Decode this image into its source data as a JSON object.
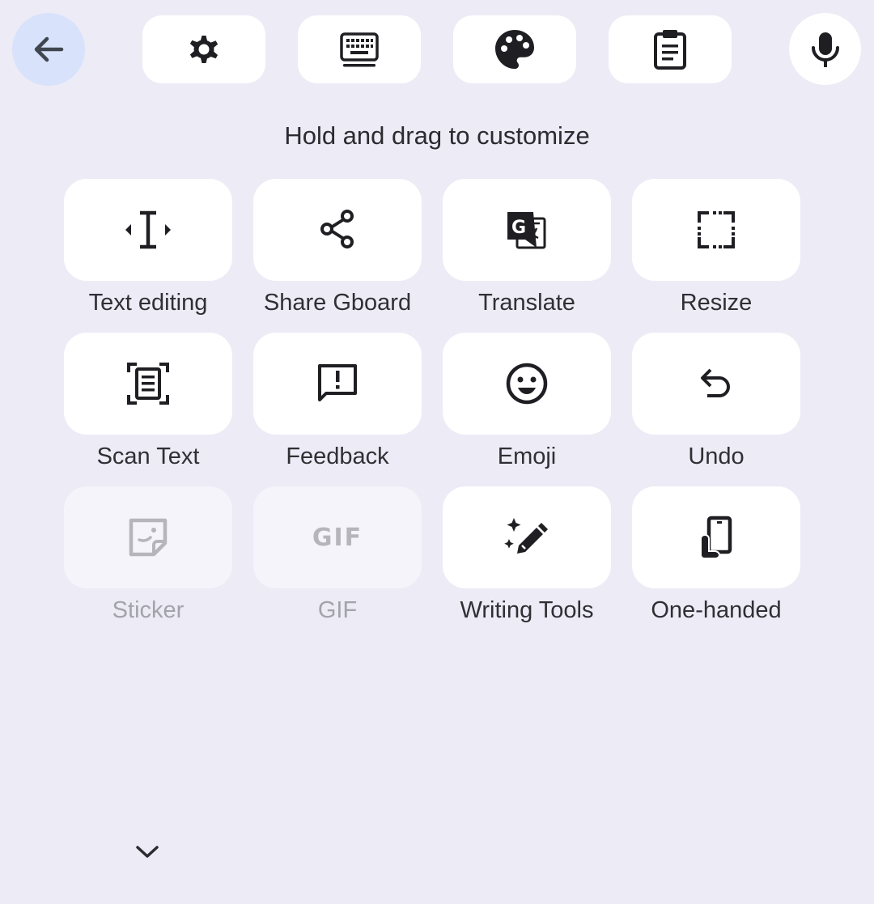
{
  "toolbar": {
    "back_icon": "arrow-left-icon",
    "items": [
      {
        "icon": "gear-icon"
      },
      {
        "icon": "keyboard-icon"
      },
      {
        "icon": "palette-icon"
      },
      {
        "icon": "clipboard-icon"
      }
    ],
    "mic_icon": "microphone-icon"
  },
  "instruction": "Hold and drag to customize",
  "tools": [
    {
      "label": "Text editing",
      "icon": "text-cursor-icon",
      "enabled": true
    },
    {
      "label": "Share Gboard",
      "icon": "share-icon",
      "enabled": true
    },
    {
      "label": "Translate",
      "icon": "translate-icon",
      "enabled": true
    },
    {
      "label": "Resize",
      "icon": "resize-icon",
      "enabled": true
    },
    {
      "label": "Scan Text",
      "icon": "scan-text-icon",
      "enabled": true
    },
    {
      "label": "Feedback",
      "icon": "feedback-icon",
      "enabled": true
    },
    {
      "label": "Emoji",
      "icon": "emoji-icon",
      "enabled": true
    },
    {
      "label": "Undo",
      "icon": "undo-icon",
      "enabled": true
    },
    {
      "label": "Sticker",
      "icon": "sticker-icon",
      "enabled": false
    },
    {
      "label": "GIF",
      "icon": "gif-icon",
      "icon_text": "GIF",
      "enabled": false
    },
    {
      "label": "Writing Tools",
      "icon": "magic-pen-icon",
      "enabled": true
    },
    {
      "label": "One-handed",
      "icon": "one-handed-icon",
      "enabled": true
    }
  ],
  "footer": {
    "collapse_icon": "chevron-down-icon"
  },
  "colors": {
    "background": "#ecebf6",
    "tile": "#ffffff",
    "tile_disabled": "#f4f4fa",
    "back_button": "#d8e2fb",
    "icon": "#1f1f23",
    "label_disabled": "#a3a3aa"
  }
}
